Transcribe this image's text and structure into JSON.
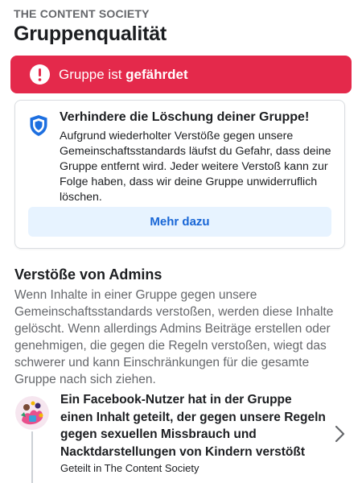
{
  "header": {
    "group_name": "THE CONTENT SOCIETY",
    "title": "Gruppenqualität"
  },
  "alert": {
    "prefix": "Gruppe ist",
    "status": "gefährdet",
    "color": "#e4294b"
  },
  "card": {
    "icon": "shield-icon",
    "title": "Verhindere die Löschung deiner Gruppe!",
    "body": "Aufgrund wiederholter Verstöße gegen unsere Gemeinschaftsstandards läufst du Gefahr, dass deine Gruppe entfernt wird. Jeder weitere Verstoß kann zur Folge haben, dass wir deine Gruppe unwiderruflich löschen.",
    "button_label": "Mehr dazu"
  },
  "admin_violations": {
    "title": "Verstöße von Admins",
    "description": "Wenn Inhalte in einer Gruppe gegen unsere Gemeinschaftsstandards verstoßen, werden diese Inhalte gelöscht. Wenn allerdings Admins Beiträge erstellen oder genehmigen, die gegen die Regeln verstoßen, wiegt das schwerer und kann Einschränkungen für die gesamte Gruppe nach sich ziehen."
  },
  "violations": [
    {
      "title": "Ein Facebook-Nutzer hat in der Gruppe einen Inhalt geteilt, der gegen unsere Regeln gegen sexuellen Missbrauch und Nacktdarstellungen von Kindern verstößt",
      "meta": "Geteilt in The Content Society"
    }
  ],
  "colors": {
    "link_blue": "#1866d6",
    "button_bg": "#e7f3ff",
    "secondary_text": "#65676b"
  }
}
